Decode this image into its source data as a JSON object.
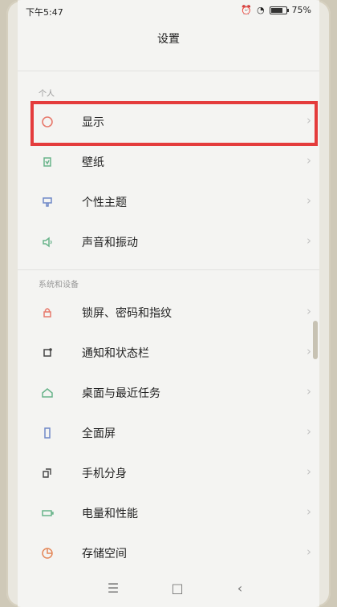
{
  "status_bar": {
    "time": "下午5:47",
    "battery": "75%",
    "battery_level": 0.75
  },
  "header": {
    "title": "设置"
  },
  "sections": [
    {
      "title": "个人",
      "items": [
        {
          "label": "显示",
          "icon": "display-icon"
        },
        {
          "label": "壁纸",
          "icon": "wallpaper-icon"
        },
        {
          "label": "个性主题",
          "icon": "theme-icon"
        },
        {
          "label": "声音和振动",
          "icon": "sound-icon"
        }
      ]
    },
    {
      "title": "系统和设备",
      "items": [
        {
          "label": "锁屏、密码和指纹",
          "icon": "lock-icon"
        },
        {
          "label": "通知和状态栏",
          "icon": "notification-icon"
        },
        {
          "label": "桌面与最近任务",
          "icon": "home-icon"
        },
        {
          "label": "全面屏",
          "icon": "fullscreen-icon"
        },
        {
          "label": "手机分身",
          "icon": "clone-icon"
        },
        {
          "label": "电量和性能",
          "icon": "battery-icon"
        },
        {
          "label": "存储空间",
          "icon": "storage-icon"
        }
      ]
    }
  ],
  "colors": {
    "highlight": "#e43c3c",
    "icon_red": "#e77a6d",
    "icon_green": "#68b38a",
    "icon_blue": "#6f88c7",
    "icon_orange": "#e48759",
    "chevron": "#c4c4c4"
  }
}
